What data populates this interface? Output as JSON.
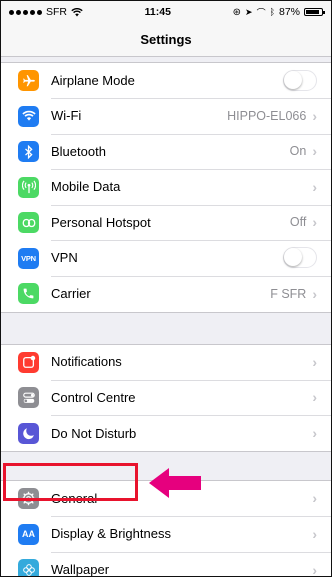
{
  "status": {
    "carrier": "SFR",
    "time": "11:45",
    "battery": "87%",
    "battery_level": 0.87
  },
  "header": {
    "title": "Settings"
  },
  "sections": [
    [
      {
        "label": "Airplane Mode",
        "icon": "airplane-icon",
        "color": "#ff9500",
        "control": "toggle",
        "on": false
      },
      {
        "label": "Wi-Fi",
        "icon": "wifi-icon",
        "color": "#1f7cf2",
        "value": "HIPPO-EL066"
      },
      {
        "label": "Bluetooth",
        "icon": "bluetooth-icon",
        "color": "#1f7cf2",
        "value": "On"
      },
      {
        "label": "Mobile Data",
        "icon": "antenna-icon",
        "color": "#4cd964"
      },
      {
        "label": "Personal Hotspot",
        "icon": "hotspot-icon",
        "color": "#4cd964",
        "value": "Off"
      },
      {
        "label": "VPN",
        "icon": "vpn-icon",
        "color": "#1f7cf2",
        "control": "toggle",
        "on": false
      },
      {
        "label": "Carrier",
        "icon": "phone-icon",
        "color": "#4cd964",
        "value": "F SFR"
      }
    ],
    [
      {
        "label": "Notifications",
        "icon": "notifications-icon",
        "color": "#ff3b30"
      },
      {
        "label": "Control Centre",
        "icon": "control-centre-icon",
        "color": "#8e8e93"
      },
      {
        "label": "Do Not Disturb",
        "icon": "moon-icon",
        "color": "#5856d6"
      }
    ],
    [
      {
        "label": "General",
        "icon": "gear-icon",
        "color": "#8e8e93"
      },
      {
        "label": "Display & Brightness",
        "icon": "display-icon",
        "color": "#1f7cf2"
      },
      {
        "label": "Wallpaper",
        "icon": "wallpaper-icon",
        "color": "#34aadc"
      }
    ]
  ],
  "annotation": {
    "highlight_color": "#e8132d",
    "arrow_color": "#e6007e"
  }
}
